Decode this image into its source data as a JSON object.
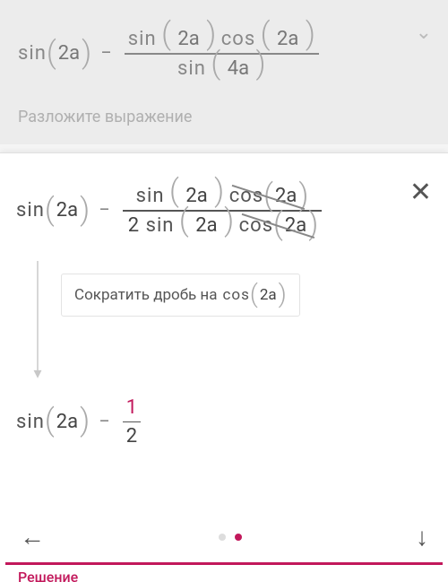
{
  "top": {
    "funcSin": "sin",
    "funcCos": "cos",
    "arg2a": "2a",
    "arg4a": "4a",
    "minus": "−",
    "caption": "Разложите выражение"
  },
  "sheet": {
    "funcSin": "sin",
    "funcCos": "cos",
    "arg2a": "2a",
    "minus": "−",
    "two": "2",
    "hintText": "Сократить дробь на",
    "hintFunc": "cos",
    "hintArg": "2a",
    "resultNum": "1",
    "resultDen": "2"
  },
  "footer": {
    "label": "Решение"
  }
}
